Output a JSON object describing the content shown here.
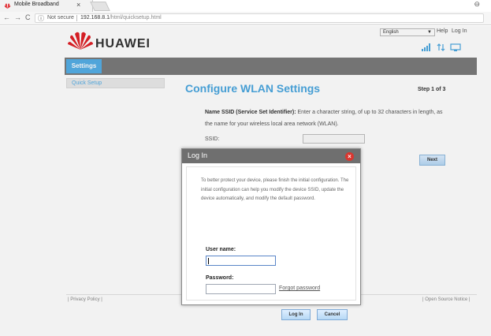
{
  "browser": {
    "tab_title": "Mobile Broadband",
    "tab_close": "×",
    "security_label": "Not secure",
    "url_host": "192.168.8.1",
    "url_path": "/html/quicksetup.html",
    "nav_back": "←",
    "nav_forward": "→",
    "nav_reload": "C",
    "profile_icon": "⊖"
  },
  "header": {
    "brand": "HUAWEI",
    "language": "English",
    "help": "Help",
    "login": "Log In"
  },
  "menu": {
    "active": "Settings"
  },
  "sidebar": {
    "items": [
      {
        "label": "Quick Setup"
      }
    ]
  },
  "main": {
    "title": "Configure WLAN Settings",
    "step": "Step 1 of 3",
    "ssid_heading": "Name SSID (Service Set Identifier):",
    "ssid_desc": " Enter a character string, of up to 32 characters in length, as the name for your wireless local area network (WLAN).",
    "ssid_label": "SSID:",
    "ssid_value": "",
    "next": "Next"
  },
  "footer": {
    "left": "| Privacy Policy |",
    "right": "| Open Source Notice |"
  },
  "login_dialog": {
    "title": "Log In",
    "message": "To better protect your device, please finish the initial configuration. The initial configuration can help you modify the device SSID, update the device automatically, and modify the default password.",
    "username_label": "User name:",
    "username_value": "",
    "password_label": "Password:",
    "password_value": "",
    "forgot": "Forgot password",
    "login_button": "Log In",
    "cancel_button": "Cancel"
  },
  "colors": {
    "accent_blue": "#4aa7e0",
    "menu_gray": "#7b7b7b",
    "close_red": "#d9362f",
    "huawei_red": "#e02026"
  }
}
